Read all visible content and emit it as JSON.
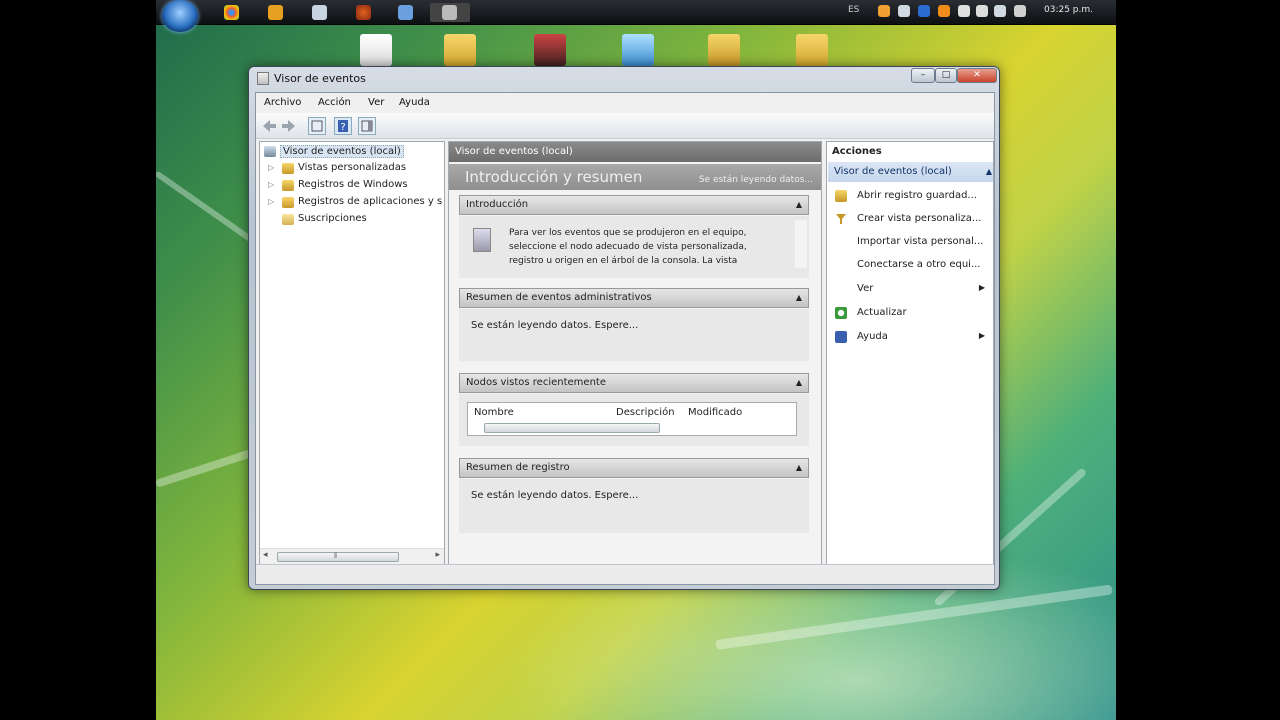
{
  "taskbar": {
    "language": "ES",
    "clock": "03:25 p.m.",
    "apps": [
      "chrome-icon",
      "media-player-icon",
      "explorer-icon",
      "firefox-icon",
      "network-icon",
      "document-icon"
    ]
  },
  "window": {
    "title": "Visor de eventos",
    "minimize": "–",
    "maximize": "□",
    "close": "✕"
  },
  "menu": [
    "Archivo",
    "Acción",
    "Ver",
    "Ayuda"
  ],
  "tree": {
    "items": [
      {
        "label": "Visor de eventos (local)",
        "level": 0,
        "expander": "",
        "selected": true
      },
      {
        "label": "Vistas personalizadas",
        "level": 1,
        "expander": "▷"
      },
      {
        "label": "Registros de Windows",
        "level": 1,
        "expander": "▷"
      },
      {
        "label": "Registros de aplicaciones y s",
        "level": 1,
        "expander": "▷"
      },
      {
        "label": "Suscripciones",
        "level": 1,
        "expander": ""
      }
    ],
    "scroll_left": "◂",
    "scroll_right": "▸",
    "grip": "⦀"
  },
  "center": {
    "header": "Visor de eventos (local)",
    "band_title": "Introducción y resumen",
    "band_status": "Se están leyendo datos...",
    "sections": {
      "intro": {
        "title": "Introducción",
        "text": "Para ver los eventos que se produjeron en el equipo, seleccione el nodo adecuado de vista personalizada, registro u origen en el árbol de la consola. La vista personalizada Eventos administrativos contiene todos"
      },
      "admin": {
        "title": "Resumen de eventos administrativos",
        "text": "Se están leyendo datos. Espere..."
      },
      "recent": {
        "title": "Nodos vistos recientemente",
        "columns": [
          "Nombre",
          "Descripción",
          "Modificado"
        ]
      },
      "log": {
        "title": "Resumen de registro",
        "text": "Se están leyendo datos. Espere..."
      }
    },
    "caret": "▲"
  },
  "actions": {
    "title": "Acciones",
    "group": "Visor de eventos (local)",
    "group_caret": "▲",
    "items": [
      {
        "label": "Abrir registro guardad...",
        "icon": "folder-open-icon",
        "submenu": ""
      },
      {
        "label": "Crear vista personaliza...",
        "icon": "filter-icon",
        "submenu": ""
      },
      {
        "label": "Importar vista personal...",
        "icon": "",
        "submenu": ""
      },
      {
        "label": "Conectarse a otro equi...",
        "icon": "",
        "submenu": ""
      },
      {
        "label": "Ver",
        "icon": "",
        "submenu": "▶"
      },
      {
        "label": "Actualizar",
        "icon": "refresh-icon",
        "submenu": ""
      },
      {
        "label": "Ayuda",
        "icon": "help-icon",
        "submenu": "▶"
      }
    ]
  }
}
